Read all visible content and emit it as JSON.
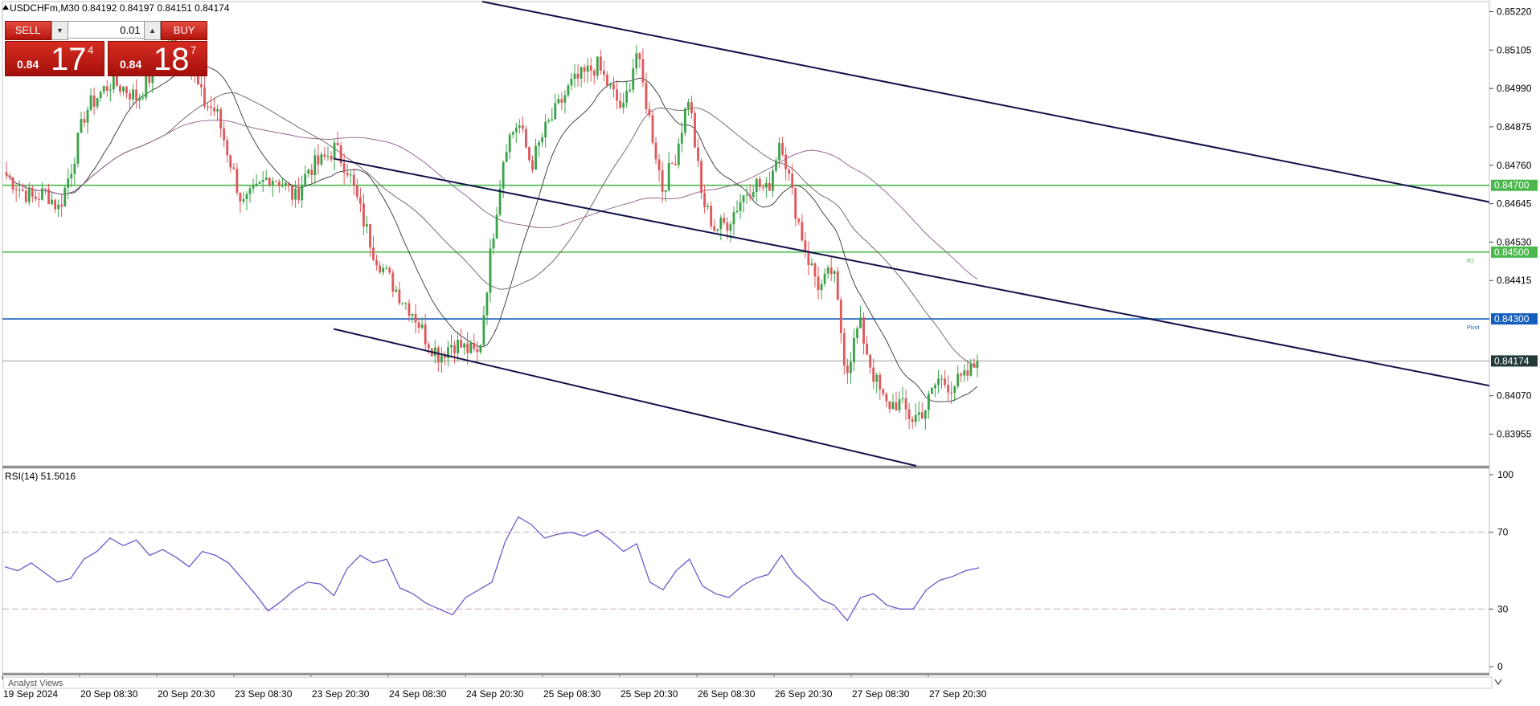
{
  "header": {
    "symbol_line": "USDCHFm,M30  0.84192 0.84197 0.84151 0.84174"
  },
  "trade_panel": {
    "sell_label": "SELL",
    "buy_label": "BUY",
    "lot": "0.01",
    "sell_price_prefix": "0.84",
    "sell_price_big": "17",
    "sell_price_sup": "4",
    "buy_price_prefix": "0.84",
    "buy_price_big": "18",
    "buy_price_sup": "7"
  },
  "bottom_bar": {
    "analyst_views": "Analyst Views"
  },
  "chart_data": [
    {
      "type": "candlestick",
      "symbol": "USDCHFm",
      "timeframe": "M30",
      "ohlc_readout": {
        "open": 0.84192,
        "high": 0.84197,
        "low": 0.84151,
        "close": 0.84174
      },
      "y_ticks": [
        "0.85220",
        "0.85105",
        "0.84990",
        "0.84875",
        "0.84760",
        "0.84645",
        "0.84530",
        "0.84415",
        "0.84070",
        "0.83955"
      ],
      "ylim": [
        0.8386,
        0.8525
      ],
      "x_ticks": [
        "19 Sep 2024",
        "20 Sep 08:30",
        "20 Sep 20:30",
        "23 Sep 08:30",
        "23 Sep 20:30",
        "24 Sep 08:30",
        "24 Sep 20:30",
        "25 Sep 08:30",
        "25 Sep 20:30",
        "26 Sep 08:30",
        "26 Sep 20:30",
        "27 Sep 08:30",
        "27 Sep 20:30"
      ],
      "current_price": "0.84174",
      "horizontal_levels": [
        {
          "price": 0.847,
          "label": "0.84700",
          "color": "#4cb84c",
          "tag": ""
        },
        {
          "price": 0.845,
          "label": "0.84500",
          "color": "#4cb84c",
          "tag": "R2"
        },
        {
          "price": 0.843,
          "label": "0.84300",
          "color": "#1560bd",
          "tag": "Pivot"
        }
      ],
      "close_path": [
        0.8473,
        0.8469,
        0.8466,
        0.8468,
        0.8463,
        0.8476,
        0.8492,
        0.8497,
        0.8501,
        0.8499,
        0.8496,
        0.8503,
        0.8509,
        0.8516,
        0.8506,
        0.8495,
        0.8492,
        0.8478,
        0.8464,
        0.8468,
        0.8473,
        0.8471,
        0.8466,
        0.8475,
        0.8477,
        0.8481,
        0.8475,
        0.8462,
        0.845,
        0.8443,
        0.8437,
        0.8432,
        0.8424,
        0.8419,
        0.8423,
        0.8421,
        0.8419,
        0.8453,
        0.8482,
        0.8489,
        0.8476,
        0.8486,
        0.8493,
        0.85,
        0.8503,
        0.8506,
        0.8499,
        0.8492,
        0.851,
        0.849,
        0.8469,
        0.8479,
        0.8497,
        0.8466,
        0.8457,
        0.8459,
        0.8466,
        0.8471,
        0.8468,
        0.8485,
        0.8465,
        0.8449,
        0.8439,
        0.8445,
        0.8414,
        0.8429,
        0.8414,
        0.8404,
        0.8405,
        0.84,
        0.8403,
        0.8412,
        0.841,
        0.8412,
        0.8417
      ],
      "trend_channel": [
        {
          "p1": [
            "20 Sep 20:30",
            0.8525
          ],
          "p2": [
            "30 Sep",
            0.8465
          ]
        },
        {
          "p1": [
            "23 Sep 20:30",
            0.8478
          ],
          "p2": [
            "30 Sep",
            0.841
          ]
        },
        {
          "p1": [
            "23 Sep 20:30",
            0.8427
          ],
          "p2": [
            "27 Sep 14:00",
            0.8386
          ]
        }
      ]
    },
    {
      "type": "line",
      "name": "RSI(14) 51.5016",
      "indicator": "RSI",
      "period": 14,
      "current": 51.5016,
      "y_ticks": [
        "100",
        "70",
        "30",
        "0"
      ],
      "ylim": [
        0,
        100
      ],
      "levels": [
        70,
        30
      ],
      "values": [
        52,
        50,
        54,
        49,
        44,
        46,
        56,
        60,
        67,
        63,
        66,
        58,
        61,
        57,
        52,
        60,
        58,
        54,
        46,
        38,
        29,
        34,
        40,
        44,
        43,
        37,
        51,
        58,
        54,
        56,
        41,
        38,
        33,
        30,
        27,
        36,
        40,
        44,
        65,
        78,
        74,
        67,
        69,
        70,
        68,
        71,
        66,
        60,
        64,
        44,
        40,
        50,
        56,
        42,
        38,
        36,
        42,
        46,
        48,
        58,
        48,
        42,
        35,
        32,
        24,
        36,
        38,
        32,
        30,
        30,
        40,
        45,
        47,
        50,
        51.5
      ]
    }
  ]
}
